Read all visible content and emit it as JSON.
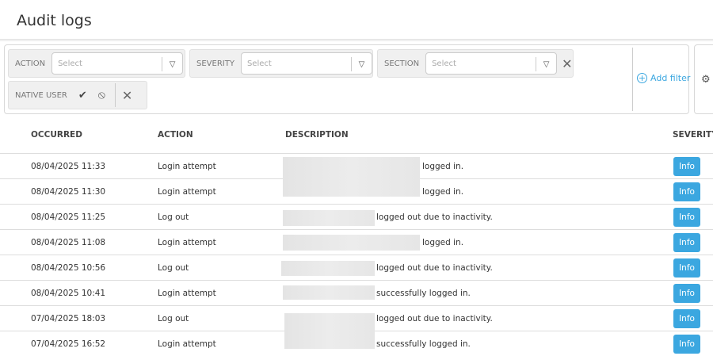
{
  "title": "Audit logs",
  "filters": {
    "action": {
      "label": "ACTION",
      "placeholder": "Select"
    },
    "severity": {
      "label": "SEVERITY",
      "placeholder": "Select"
    },
    "section": {
      "label": "SECTION",
      "placeholder": "Select"
    },
    "native_user": {
      "label": "NATIVE USER"
    },
    "add_filter": "Add filter"
  },
  "table": {
    "headers": [
      "OCCURRED",
      "ACTION",
      "DESCRIPTION",
      "SEVERITY"
    ],
    "rows": [
      {
        "occurred": "08/04/2025 11:33",
        "action": "Login attempt",
        "description": "logged in.",
        "severity": "Info"
      },
      {
        "occurred": "08/04/2025 11:30",
        "action": "Login attempt",
        "description": "logged in.",
        "severity": "Info"
      },
      {
        "occurred": "08/04/2025 11:25",
        "action": "Log out",
        "description": "logged out due to inactivity.",
        "severity": "Info"
      },
      {
        "occurred": "08/04/2025 11:08",
        "action": "Login attempt",
        "description": "logged in.",
        "severity": "Info"
      },
      {
        "occurred": "08/04/2025 10:56",
        "action": "Log out",
        "description": "logged out due to inactivity.",
        "severity": "Info"
      },
      {
        "occurred": "08/04/2025 10:41",
        "action": "Login attempt",
        "description": "successfully logged in.",
        "severity": "Info"
      },
      {
        "occurred": "07/04/2025 18:03",
        "action": "Log out",
        "description": "logged out due to inactivity.",
        "severity": "Info"
      },
      {
        "occurred": "07/04/2025 16:52",
        "action": "Login attempt",
        "description": "successfully logged in.",
        "severity": "Info"
      }
    ]
  }
}
